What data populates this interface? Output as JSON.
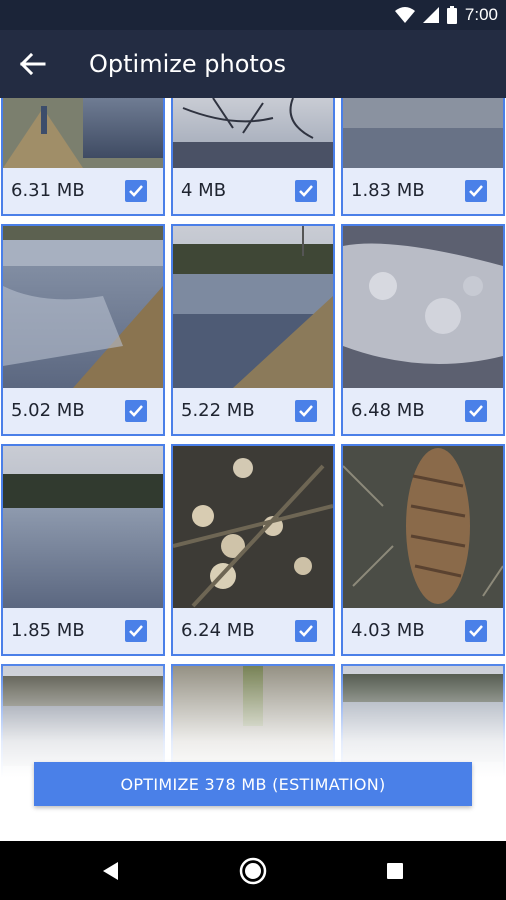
{
  "status_bar": {
    "time": "7:00",
    "icons": [
      "wifi-icon",
      "signal-icon",
      "battery-icon"
    ]
  },
  "app_bar": {
    "title": "Optimize photos",
    "back_icon": "arrow-left-icon"
  },
  "photos": [
    {
      "size": "6.31 MB",
      "selected": true
    },
    {
      "size": "4 MB",
      "selected": true
    },
    {
      "size": "1.83 MB",
      "selected": true
    },
    {
      "size": "5.02 MB",
      "selected": true
    },
    {
      "size": "5.22 MB",
      "selected": true
    },
    {
      "size": "6.48 MB",
      "selected": true
    },
    {
      "size": "1.85 MB",
      "selected": true
    },
    {
      "size": "6.24 MB",
      "selected": true
    },
    {
      "size": "4.03 MB",
      "selected": true
    },
    {
      "size": "",
      "selected": true
    },
    {
      "size": "",
      "selected": true
    },
    {
      "size": "",
      "selected": true
    }
  ],
  "optimize_button": {
    "label": "OPTIMIZE 378 MB (ESTIMATION)"
  },
  "nav_bar": {
    "icons": [
      "back-triangle-icon",
      "home-circle-icon",
      "recents-square-icon"
    ]
  },
  "colors": {
    "accent": "#4a80e8",
    "app_bar": "#232c42",
    "status_bar": "#1b2438"
  }
}
